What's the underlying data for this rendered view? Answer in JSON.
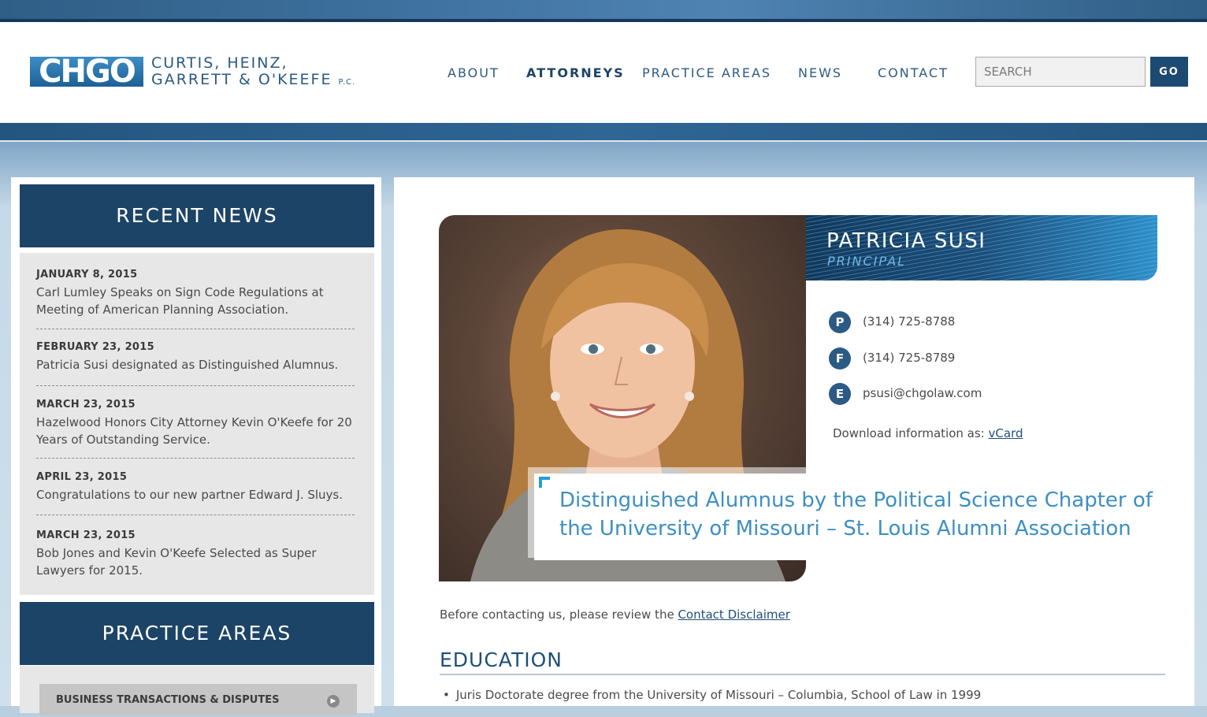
{
  "brand": {
    "logo_mark": "CHGO",
    "name_line1": "CURTIS, HEINZ,",
    "name_line2": "GARRETT & O'KEEFE",
    "name_suffix": "P.C."
  },
  "nav": {
    "items": [
      {
        "label": "ABOUT",
        "active": false
      },
      {
        "label": "ATTORNEYS",
        "active": true
      },
      {
        "label": "PRACTICE AREAS",
        "active": false
      },
      {
        "label": "NEWS",
        "active": false
      },
      {
        "label": "CONTACT",
        "active": false
      }
    ]
  },
  "search": {
    "placeholder": "SEARCH",
    "button_label": "GO"
  },
  "sidebar": {
    "recent_news_title": "RECENT NEWS",
    "news": [
      {
        "date": "JANUARY 8, 2015",
        "text": "Carl Lumley Speaks on Sign Code Regulations at Meeting of American Planning Association."
      },
      {
        "date": "FEBRUARY 23, 2015",
        "text": "Patricia Susi designated as Distinguished Alumnus."
      },
      {
        "date": "MARCH 23, 2015",
        "text": "Hazelwood Honors City Attorney Kevin O'Keefe for 20 Years of Outstanding Service."
      },
      {
        "date": "APRIL 23, 2015",
        "text": "Congratulations to our new partner Edward J. Sluys."
      },
      {
        "date": "MARCH 23, 2015",
        "text": "Bob Jones and Kevin O'Keefe Selected as Super Lawyers for 2015."
      }
    ],
    "practice_areas_title": "PRACTICE AREAS",
    "practice_areas": [
      {
        "label": "BUSINESS TRANSACTIONS & DISPUTES"
      }
    ]
  },
  "attorney": {
    "name": "PATRICIA SUSI",
    "title": "PRINCIPAL",
    "contacts": [
      {
        "badge": "P",
        "value": "(314) 725-8788"
      },
      {
        "badge": "F",
        "value": "(314) 725-8789"
      },
      {
        "badge": "E",
        "value": "psusi@chgolaw.com"
      }
    ],
    "download_label": "Download information as: ",
    "download_link": "vCard",
    "quote": "Distinguished Alumnus by the Political Science Chapter of the University of Missouri – St. Louis Alumni Association"
  },
  "disclaimer": {
    "text": "Before contacting us, please review the ",
    "link": "Contact Disclaimer"
  },
  "education": {
    "title": "EDUCATION",
    "items": [
      "Juris Doctorate degree from the University of Missouri – Columbia, School of Law in 1999"
    ]
  },
  "colors": {
    "navy": "#1c4467",
    "accent_blue": "#3d8fc4",
    "sidebar_bg": "#e7e7e8"
  }
}
